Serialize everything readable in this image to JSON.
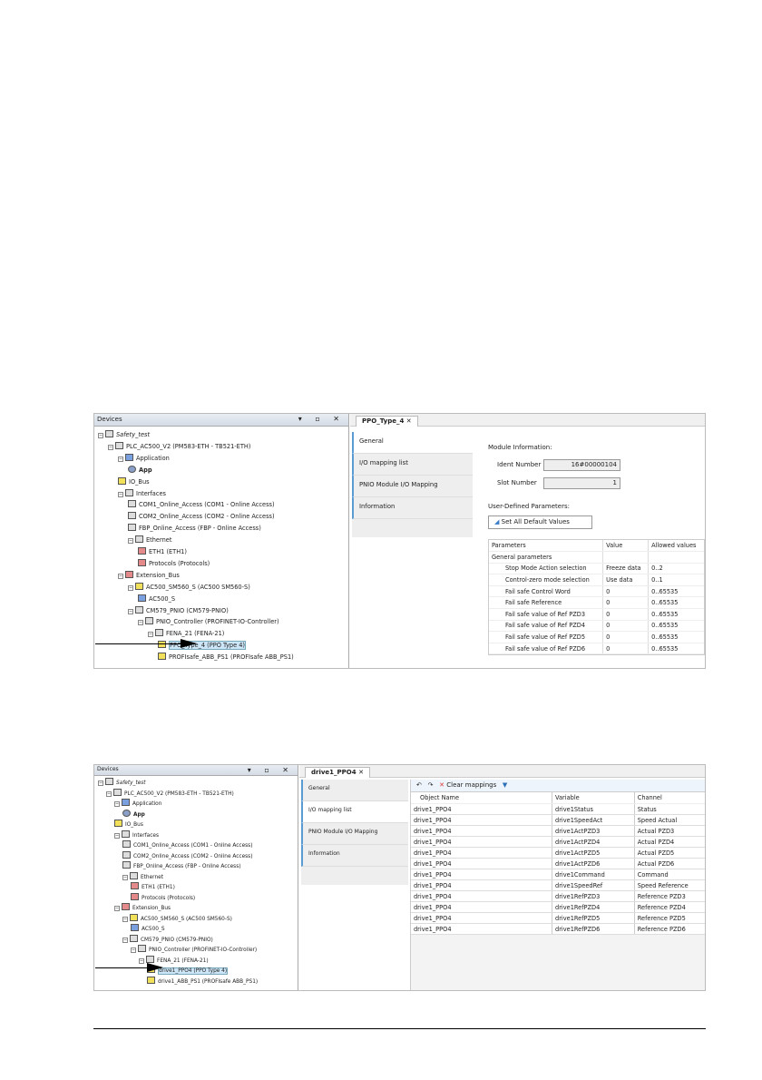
{
  "shot1": {
    "panel_title": "Devices",
    "tree": [
      {
        "l": 0,
        "t": "Safety_test",
        "ic": "",
        "it": true
      },
      {
        "l": 1,
        "t": "PLC_AC500_V2 (PM583-ETH - TB521-ETH)",
        "ic": ""
      },
      {
        "l": 2,
        "t": "Application",
        "ic": "blue"
      },
      {
        "l": 3,
        "t": "App",
        "ic": "gear",
        "b": true
      },
      {
        "l": 2,
        "t": "IO_Bus",
        "ic": "yel"
      },
      {
        "l": 2,
        "t": "Interfaces",
        "ic": ""
      },
      {
        "l": 3,
        "t": "COM1_Online_Access (COM1 - Online Access)",
        "ic": ""
      },
      {
        "l": 3,
        "t": "COM2_Online_Access (COM2 - Online Access)",
        "ic": ""
      },
      {
        "l": 3,
        "t": "FBP_Online_Access (FBP - Online Access)",
        "ic": ""
      },
      {
        "l": 3,
        "t": "Ethernet",
        "ic": ""
      },
      {
        "l": 4,
        "t": "ETH1 (ETH1)",
        "ic": "red"
      },
      {
        "l": 4,
        "t": "Protocols (Protocols)",
        "ic": "red"
      },
      {
        "l": 2,
        "t": "Extension_Bus",
        "ic": "red"
      },
      {
        "l": 3,
        "t": "AC500_SM560_S (AC500 SM560-S)",
        "ic": "yel"
      },
      {
        "l": 4,
        "t": "AC500_S",
        "ic": "blue"
      },
      {
        "l": 3,
        "t": "CM579_PNIO (CM579-PNIO)",
        "ic": ""
      },
      {
        "l": 4,
        "t": "PNIO_Controller (PROFINET-IO-Controller)",
        "ic": ""
      },
      {
        "l": 5,
        "t": "FENA_21 (FENA-21)",
        "ic": ""
      },
      {
        "l": 6,
        "t": "PPO_Type_4 (PPO Type 4)",
        "ic": "yel",
        "sel": true
      },
      {
        "l": 6,
        "t": "PROFIsafe_ABB_PS1 (PROFIsafe ABB_PS1)",
        "ic": "yel"
      }
    ],
    "tab": "PPO_Type_4",
    "vtabs": [
      "General",
      "I/O mapping list",
      "PNIO Module I/O Mapping",
      "Information"
    ],
    "active_vtab": 0,
    "module_info": "Module Information:",
    "ident_label": "Ident Number",
    "ident_value": "16#00000104",
    "slot_label": "Slot Number",
    "slot_value": "1",
    "user_params": "User-Defined Parameters:",
    "default_button": "Set All Default Values",
    "columns": [
      "Parameters",
      "Value",
      "Allowed values"
    ],
    "group": "General parameters",
    "params": [
      [
        "Stop Mode Action selection",
        "Freeze data",
        "0..2"
      ],
      [
        "Control-zero mode selection",
        "Use data",
        "0..1"
      ],
      [
        "Fail safe Control Word",
        "0",
        "0..65535"
      ],
      [
        "Fail safe Reference",
        "0",
        "0..65535"
      ],
      [
        "Fail safe value of Ref PZD3",
        "0",
        "0..65535"
      ],
      [
        "Fail safe value of Ref PZD4",
        "0",
        "0..65535"
      ],
      [
        "Fail safe value of Ref PZD5",
        "0",
        "0..65535"
      ],
      [
        "Fail safe value of Ref PZD6",
        "0",
        "0..65535"
      ]
    ]
  },
  "shot2": {
    "panel_title": "Devices",
    "tree": [
      {
        "l": 0,
        "t": "Safety_test",
        "ic": "",
        "it": true
      },
      {
        "l": 1,
        "t": "PLC_AC500_V2 (PM583-ETH - TB521-ETH)",
        "ic": ""
      },
      {
        "l": 2,
        "t": "Application",
        "ic": "blue"
      },
      {
        "l": 3,
        "t": "App",
        "ic": "gear",
        "b": true
      },
      {
        "l": 2,
        "t": "IO_Bus",
        "ic": "yel"
      },
      {
        "l": 2,
        "t": "Interfaces",
        "ic": ""
      },
      {
        "l": 3,
        "t": "COM1_Online_Access (COM1 - Online Access)",
        "ic": ""
      },
      {
        "l": 3,
        "t": "COM2_Online_Access (COM2 - Online Access)",
        "ic": ""
      },
      {
        "l": 3,
        "t": "FBP_Online_Access (FBP - Online Access)",
        "ic": ""
      },
      {
        "l": 3,
        "t": "Ethernet",
        "ic": ""
      },
      {
        "l": 4,
        "t": "ETH1 (ETH1)",
        "ic": "red"
      },
      {
        "l": 4,
        "t": "Protocols (Protocols)",
        "ic": "red"
      },
      {
        "l": 2,
        "t": "Extension_Bus",
        "ic": "red"
      },
      {
        "l": 3,
        "t": "AC500_SM560_S (AC500 SM560-S)",
        "ic": "yel"
      },
      {
        "l": 4,
        "t": "AC500_S",
        "ic": "blue"
      },
      {
        "l": 3,
        "t": "CM579_PNIO (CM579-PNIO)",
        "ic": ""
      },
      {
        "l": 4,
        "t": "PNIO_Controller (PROFINET-IO-Controller)",
        "ic": ""
      },
      {
        "l": 5,
        "t": "FENA_21 (FENA-21)",
        "ic": ""
      },
      {
        "l": 6,
        "t": "drive1_PPO4 (PPO Type 4)",
        "ic": "yel",
        "sel": true
      },
      {
        "l": 6,
        "t": "drive1_ABB_PS1 (PROFIsafe ABB_PS1)",
        "ic": "yel"
      }
    ],
    "tab": "drive1_PPO4",
    "vtabs": [
      "General",
      "I/O mapping list",
      "PNIO Module I/O Mapping",
      "Information"
    ],
    "active_vtab": 1,
    "clear_mappings": "Clear mappings",
    "columns": [
      "Object Name",
      "Variable",
      "Channel"
    ],
    "rows": [
      [
        "drive1_PPO4",
        "drive1Status",
        "Status"
      ],
      [
        "drive1_PPO4",
        "drive1SpeedAct",
        "Speed Actual"
      ],
      [
        "drive1_PPO4",
        "drive1ActPZD3",
        "Actual PZD3"
      ],
      [
        "drive1_PPO4",
        "drive1ActPZD4",
        "Actual PZD4"
      ],
      [
        "drive1_PPO4",
        "drive1ActPZD5",
        "Actual PZD5"
      ],
      [
        "drive1_PPO4",
        "drive1ActPZD6",
        "Actual PZD6"
      ],
      [
        "drive1_PPO4",
        "drive1Command",
        "Command"
      ],
      [
        "drive1_PPO4",
        "drive1SpeedRef",
        "Speed Reference"
      ],
      [
        "drive1_PPO4",
        "drive1RefPZD3",
        "Reference PZD3"
      ],
      [
        "drive1_PPO4",
        "drive1RefPZD4",
        "Reference PZD4"
      ],
      [
        "drive1_PPO4",
        "drive1RefPZD5",
        "Reference PZD5"
      ],
      [
        "drive1_PPO4",
        "drive1RefPZD6",
        "Reference PZD6"
      ]
    ]
  }
}
